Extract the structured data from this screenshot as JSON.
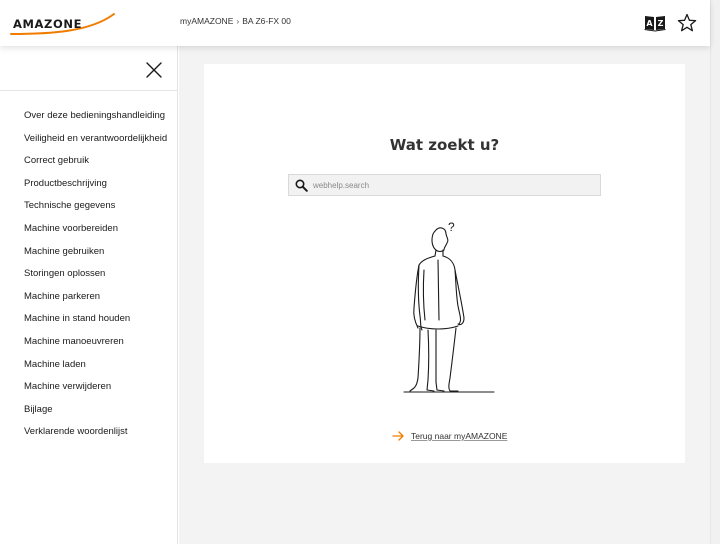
{
  "header": {
    "logo_text": "AMAZONE",
    "breadcrumb": [
      {
        "label": "myAMAZONE"
      },
      {
        "label": "BA Z6-FX 00"
      }
    ],
    "breadcrumb_separator": "›"
  },
  "icons": {
    "glossary": "book-a-z-icon",
    "favorite": "star-icon",
    "close": "close-icon",
    "search": "search-icon",
    "back": "arrow-right-icon"
  },
  "colors": {
    "accent": "#f07d00",
    "text": "#1a1a1a",
    "background": "#f3f3f3"
  },
  "sidebar": {
    "items": [
      {
        "label": "Over deze bedieningshandleiding"
      },
      {
        "label": "Veiligheid en verantwoordelijkheid"
      },
      {
        "label": "Correct gebruik"
      },
      {
        "label": "Productbeschrijving"
      },
      {
        "label": "Technische gegevens"
      },
      {
        "label": "Machine voorbereiden"
      },
      {
        "label": "Machine gebruiken"
      },
      {
        "label": "Storingen oplossen"
      },
      {
        "label": "Machine parkeren"
      },
      {
        "label": "Machine in stand houden"
      },
      {
        "label": "Machine manoeuvreren"
      },
      {
        "label": "Machine laden"
      },
      {
        "label": "Machine verwijderen"
      },
      {
        "label": "Bijlage"
      },
      {
        "label": "Verklarende woordenlijst"
      }
    ]
  },
  "main": {
    "title": "Wat zoekt u?",
    "search": {
      "placeholder": "webhelp.search",
      "value": ""
    },
    "figure_mark": "?",
    "back_link": "Terug naar myAMAZONE"
  }
}
